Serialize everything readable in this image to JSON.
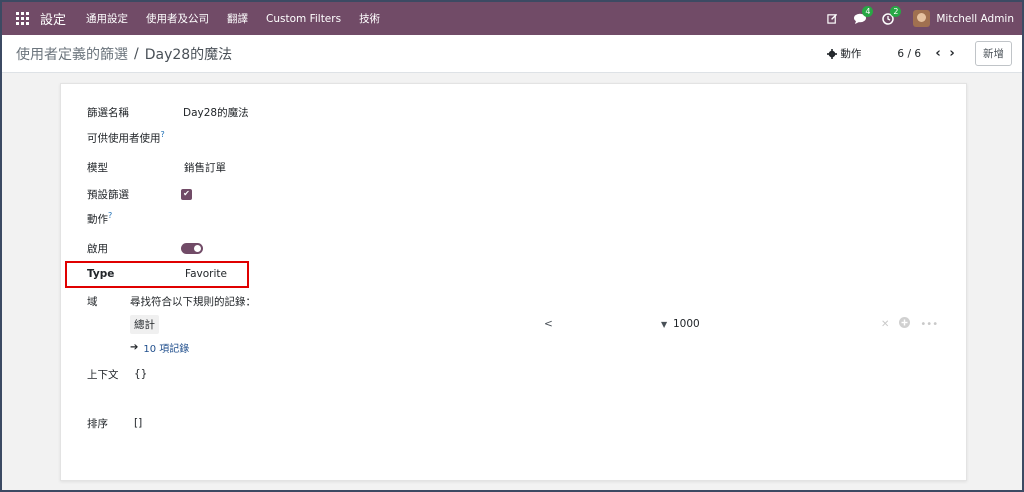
{
  "navbar": {
    "brand": "設定",
    "menu": [
      "通用設定",
      "使用者及公司",
      "翻譯",
      "Custom Filters",
      "技術"
    ],
    "messages_count": "4",
    "activities_count": "2",
    "user_name": "Mitchell Admin",
    "color": "#714b67"
  },
  "control_panel": {
    "breadcrumb_parent": "使用者定義的篩選",
    "breadcrumb_sep": "/",
    "breadcrumb_current": "Day28的魔法",
    "action_label": "動作",
    "pager": "6 / 6",
    "prev_icon": "chevron-left-icon",
    "next_icon": "chevron-right-icon",
    "new_label": "新增"
  },
  "form": {
    "filter_name_label": "篩選名稱",
    "filter_name_value": "Day28的魔法",
    "available_for_user_label": "可供使用者使用",
    "help_mark": "?",
    "model_label": "模型",
    "model_value": "銷售訂單",
    "default_filter_label": "預設篩選",
    "default_filter_checked": true,
    "action_label": "動作",
    "active_label": "啟用",
    "active_on": true,
    "type_label": "Type",
    "type_value": "Favorite",
    "domain_label": "域",
    "domain_desc": "尋找符合以下規則的記錄：",
    "domain_rule": {
      "field": "總計",
      "operator": "<",
      "value": "1000"
    },
    "records_link": "10 項記錄",
    "context_label": "上下文",
    "context_value": "{}",
    "sort_label": "排序",
    "sort_value": "[]"
  }
}
